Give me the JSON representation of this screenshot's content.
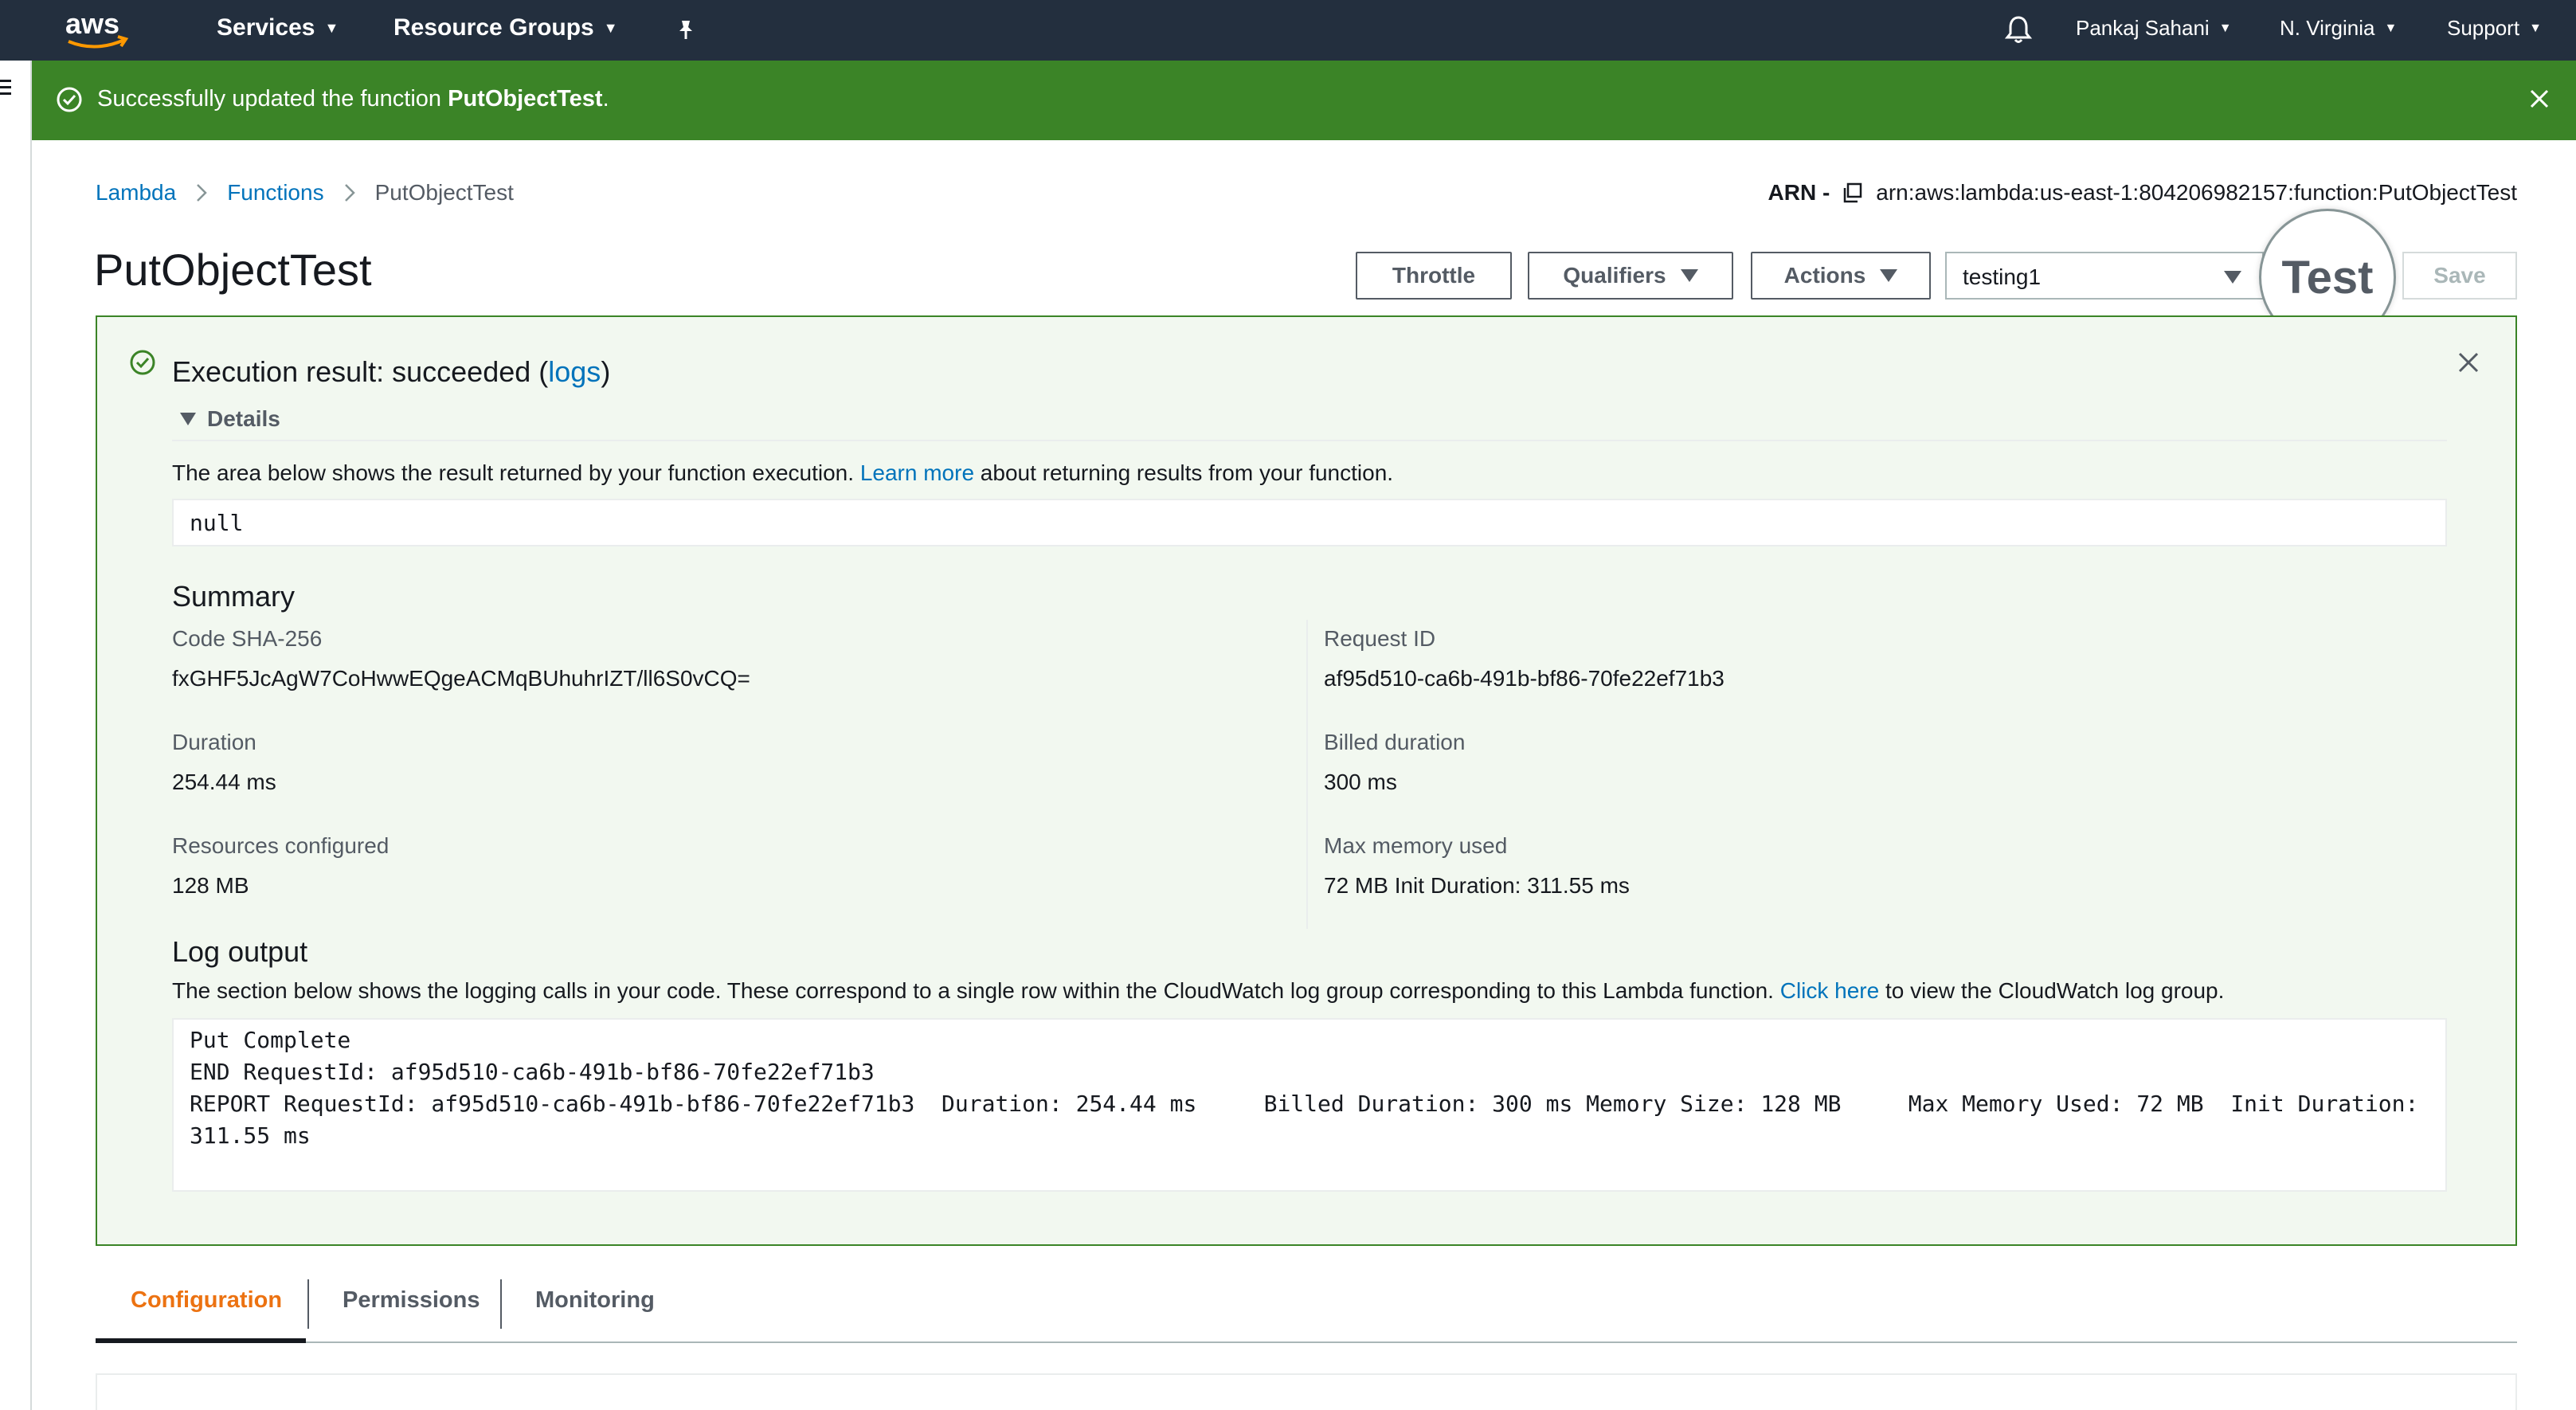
{
  "topnav": {
    "services_label": "Services",
    "resource_groups_label": "Resource Groups",
    "user_label": "Pankaj Sahani",
    "region_label": "N. Virginia",
    "support_label": "Support",
    "logo_text": "aws"
  },
  "flash": {
    "message_prefix": "Successfully updated the function ",
    "function_name": "PutObjectTest",
    "message_suffix": "."
  },
  "breadcrumb": {
    "items": [
      "Lambda",
      "Functions",
      "PutObjectTest"
    ]
  },
  "arn": {
    "label": "ARN -",
    "value": "arn:aws:lambda:us-east-1:804206982157:function:PutObjectTest"
  },
  "page": {
    "title": "PutObjectTest"
  },
  "toolbar": {
    "throttle_label": "Throttle",
    "qualifiers_label": "Qualifiers",
    "actions_label": "Actions",
    "test_event_value": "testing1",
    "test_label": "Test",
    "save_label": "Save"
  },
  "result": {
    "title_prefix": "Execution result: succeeded (",
    "logs_link": "logs",
    "title_suffix": ")",
    "details_label": "Details",
    "desc_prefix": "The area below shows the result returned by your function execution. ",
    "learn_more": "Learn more",
    "desc_suffix": " about returning results from your function.",
    "return_value": "null"
  },
  "summary": {
    "heading": "Summary",
    "code_sha_label": "Code SHA-256",
    "code_sha_value": "fxGHF5JcAgW7CoHwwEQgeACMqBUhuhrIZT/ll6S0vCQ=",
    "request_id_label": "Request ID",
    "request_id_value": "af95d510-ca6b-491b-bf86-70fe22ef71b3",
    "duration_label": "Duration",
    "duration_value": "254.44 ms",
    "billed_label": "Billed duration",
    "billed_value": "300 ms",
    "resources_label": "Resources configured",
    "resources_value": "128 MB",
    "max_mem_label": "Max memory used",
    "max_mem_value": "72 MB Init Duration: 311.55 ms"
  },
  "log": {
    "heading": "Log output",
    "desc_prefix": "The section below shows the logging calls in your code. These correspond to a single row within the CloudWatch log group corresponding to this Lambda function. ",
    "click_here": "Click here",
    "desc_suffix": " to view the CloudWatch log group.",
    "output": "Put Complete\nEND RequestId: af95d510-ca6b-491b-bf86-70fe22ef71b3\nREPORT RequestId: af95d510-ca6b-491b-bf86-70fe22ef71b3  Duration: 254.44 ms     Billed Duration: 300 ms Memory Size: 128 MB     Max Memory Used: 72 MB  Init Duration:\n311.55 ms"
  },
  "tabs": {
    "configuration": "Configuration",
    "permissions": "Permissions",
    "monitoring": "Monitoring"
  },
  "colors": {
    "nav_bg": "#232f3e",
    "success_green": "#3b8427",
    "link_blue": "#0073bb",
    "active_tab_orange": "#ec7211"
  },
  "icons": [
    "bell-icon",
    "pin-icon",
    "check-circle-icon",
    "close-icon",
    "copy-icon",
    "chevron-right-icon",
    "menu-icon"
  ]
}
